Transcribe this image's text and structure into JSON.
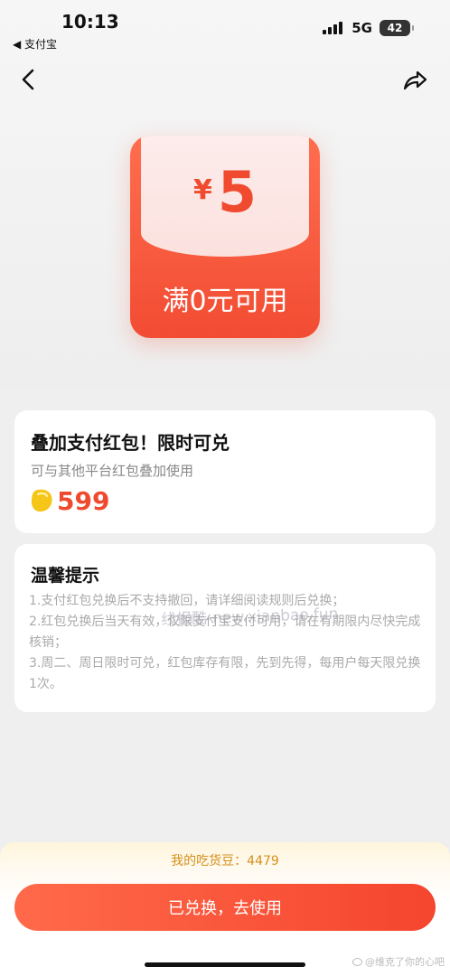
{
  "status_bar": {
    "time": "10:13",
    "back_app": "◀ 支付宝",
    "network": "5G",
    "battery": "42"
  },
  "coupon": {
    "currency": "¥",
    "amount": "5",
    "condition": "满0元可用"
  },
  "offer_card": {
    "title": "叠加支付红包！限时可兑",
    "subtitle": "可与其他平台红包叠加使用",
    "price": "599"
  },
  "tips_card": {
    "title": "温馨提示",
    "rules": [
      "1.支付红包兑换后不支持撤回，请详细阅读规则后兑换；",
      "2.红包兑换后当天有效，仅限支付宝支付可用，请在有期限内尽快完成核销；",
      "3.周二、周日限时可兑，红包库存有限，先到先得，每用户每天限兑换1次。"
    ]
  },
  "watermark": "线报酷-new.xianbao.fun",
  "footer": {
    "beans_balance": "我的吃货豆：4479",
    "action_label": "已兑换，去使用",
    "weibo_credit": "@维克了你的心吧"
  },
  "colors": {
    "accent": "#f24c33",
    "bean_gold": "#f5c518",
    "beans_text": "#d4901b"
  }
}
